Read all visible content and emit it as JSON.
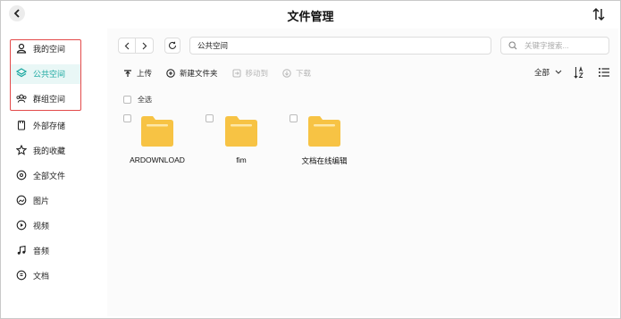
{
  "app": {
    "title": "文件管理"
  },
  "sidebar": {
    "items": [
      {
        "label": "我的空间",
        "icon": "user-icon"
      },
      {
        "label": "公共空间",
        "icon": "layers-icon",
        "active": true
      },
      {
        "label": "群组空间",
        "icon": "group-icon"
      },
      {
        "label": "外部存储",
        "icon": "storage-icon"
      },
      {
        "label": "我的收藏",
        "icon": "star-icon"
      },
      {
        "label": "全部文件",
        "icon": "all-files-icon"
      },
      {
        "label": "图片",
        "icon": "image-icon"
      },
      {
        "label": "视频",
        "icon": "video-icon"
      },
      {
        "label": "音频",
        "icon": "audio-icon"
      },
      {
        "label": "文档",
        "icon": "document-icon"
      }
    ]
  },
  "path": {
    "current": "公共空间"
  },
  "search": {
    "placeholder": "关键字搜索..."
  },
  "toolbar": {
    "upload": "上传",
    "new_folder": "新建文件夹",
    "move_to": "移动到",
    "download": "下载",
    "filter": "全部"
  },
  "list": {
    "select_all": "全选",
    "files": [
      {
        "name": "ARDOWNLOAD",
        "type": "folder"
      },
      {
        "name": "fim",
        "type": "folder"
      },
      {
        "name": "文档在线编辑",
        "type": "folder"
      }
    ]
  },
  "colors": {
    "accent": "#1aa8a0",
    "folder": "#f7c344",
    "highlight": "#e34a4a"
  }
}
